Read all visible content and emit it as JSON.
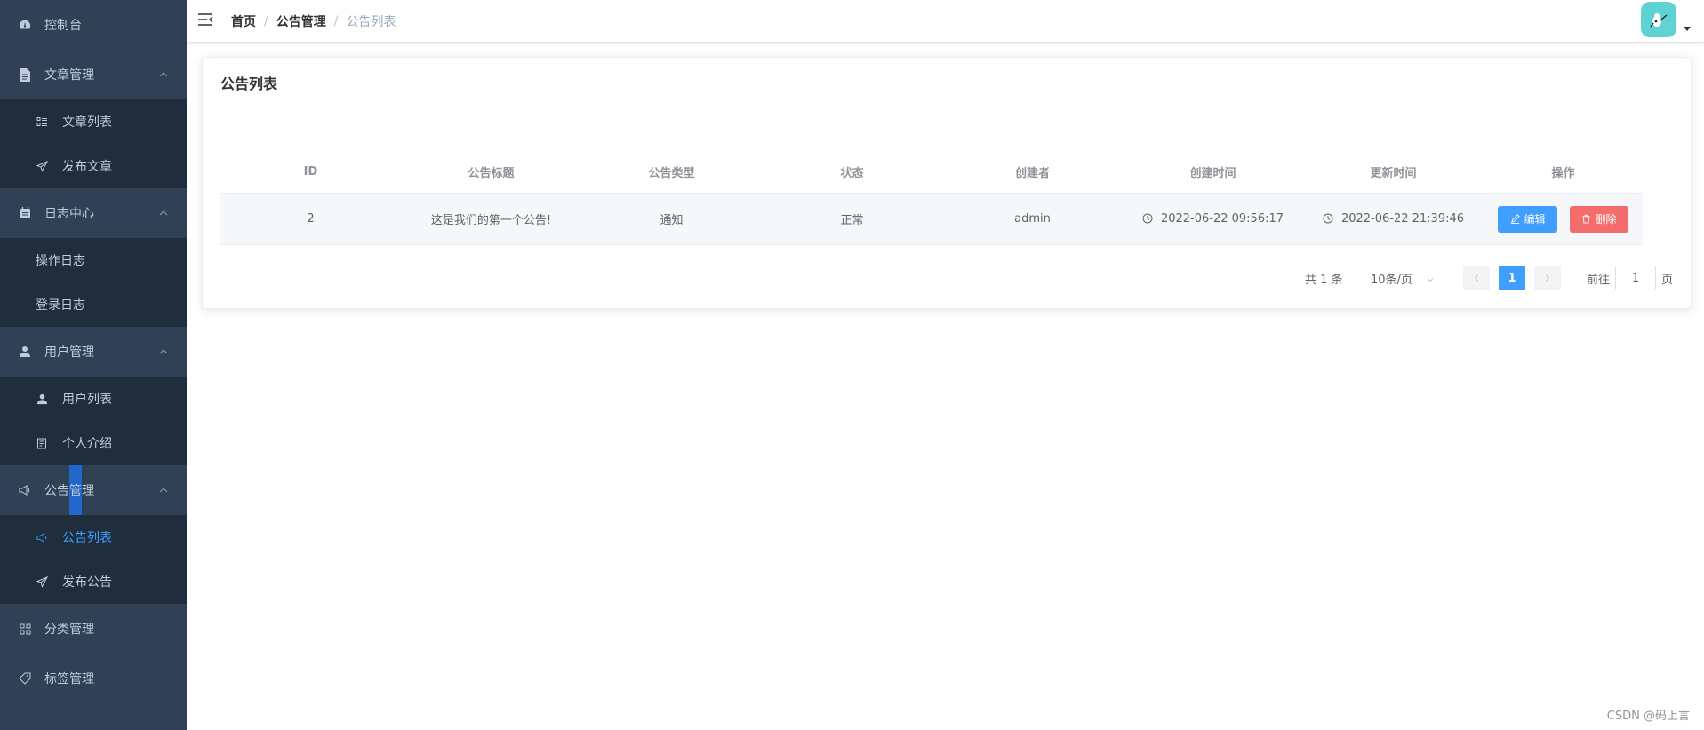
{
  "sidebar": {
    "dashboard": "控制台",
    "article_group": "文章管理",
    "article_list": "文章列表",
    "article_publish": "发布文章",
    "log_group": "日志中心",
    "log_operation": "操作日志",
    "log_login": "登录日志",
    "user_group": "用户管理",
    "user_list": "用户列表",
    "user_profile": "个人介绍",
    "notice_group": "公告管理",
    "notice_list": "公告列表",
    "notice_publish": "发布公告",
    "category": "分类管理",
    "tags": "标签管理"
  },
  "header": {
    "breadcrumb": [
      "首页",
      "公告管理",
      "公告列表"
    ],
    "separator": "/"
  },
  "card": {
    "title": "公告列表"
  },
  "table": {
    "columns": [
      "ID",
      "公告标题",
      "公告类型",
      "状态",
      "创建者",
      "创建时间",
      "更新时间",
      "操作"
    ],
    "rows": [
      {
        "id": "2",
        "title": "这是我们的第一个公告!",
        "type": "通知",
        "status": "正常",
        "creator": "admin",
        "created_at": "2022-06-22 09:56:17",
        "updated_at": "2022-06-22 21:39:46",
        "edit_label": "编辑",
        "delete_label": "删除"
      }
    ]
  },
  "pagination": {
    "total": "共 1 条",
    "page_size": "10条/页",
    "current_page": "1",
    "goto_label": "前往",
    "goto_value": "1",
    "page_suffix": "页"
  },
  "watermark": "CSDN @码上言",
  "colors": {
    "sidebar_bg": "#304156",
    "submenu_bg": "#1f2d3d",
    "primary": "#409eff",
    "danger": "#f56c6c",
    "avatar_bg": "#5fd3d3"
  }
}
